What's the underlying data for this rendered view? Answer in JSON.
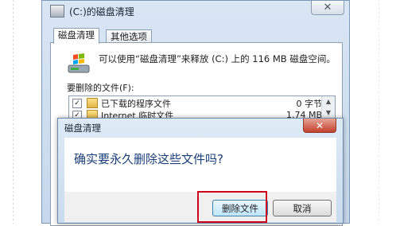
{
  "main_window": {
    "title": "(C:)的磁盘清理",
    "close_symbol": "✕",
    "tabs": [
      {
        "label": "磁盘清理",
        "active": true
      },
      {
        "label": "其他选项",
        "active": false
      }
    ],
    "description": "可以使用“磁盘清理”来释放 (C:) 上的 116 MB 磁盘空间。",
    "files_to_delete_label": "要删除的文件(F):",
    "files": [
      {
        "checked": true,
        "name": "已下载的程序文件",
        "size": "0 字节"
      },
      {
        "checked": true,
        "name": "Internet 临时文件",
        "size": "1.74 MB"
      }
    ]
  },
  "dialog": {
    "title": "磁盘清理",
    "close_symbol": "✕",
    "message": "确实要永久删除这些文件吗?",
    "delete_button": "删除文件",
    "cancel_button": "取消"
  },
  "colors": {
    "highlight": "#d0021b",
    "dialog_message": "#1a3e7a"
  }
}
